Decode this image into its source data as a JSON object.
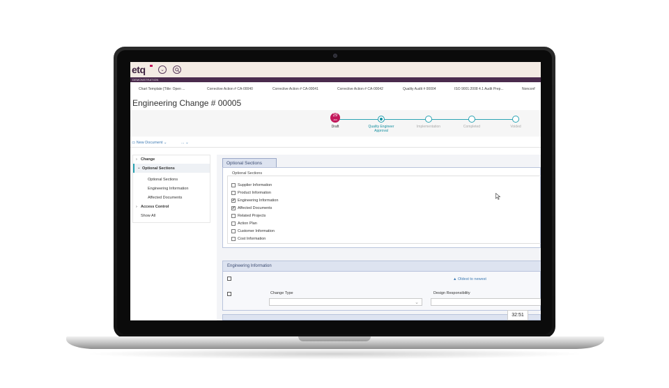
{
  "app": {
    "logo": "etq",
    "banner": "DEMONSTRATION",
    "header_icons": [
      "chevron-down-icon",
      "search-icon"
    ]
  },
  "tabs": [
    "Chart Template [Title: Open ...",
    "Corrective Action # CA-00040",
    "Corrective Action # CA-00041",
    "Corrective Action # CA-00042",
    "Quality Audit # 00004",
    "ISO 9001:2008 4.1 Audit Prep...",
    "Nonconf"
  ],
  "document": {
    "title": "Engineering Change # 00005"
  },
  "workflow": {
    "date_day": "29",
    "date_month": "JAN",
    "steps": [
      "Draft",
      "Quality Engineer Approval",
      "Implementation",
      "Completed",
      "Voided"
    ],
    "current_step": "Quality Engineer Approval"
  },
  "toolbar": {
    "new_document": "New Document ⌄",
    "more": "... ⌄"
  },
  "nav": {
    "change": "Change",
    "optional_sections": "Optional Sections",
    "sub_items": [
      "Optional Sections",
      "Engineering Information",
      "Affected Documents"
    ],
    "access_control": "Access Control",
    "show_all": "Show All"
  },
  "optional_sections": {
    "tab_label": "Optional Sections",
    "fieldset_label": "Optional Sections",
    "checkboxes": [
      {
        "label": "Supplier Information",
        "checked": false
      },
      {
        "label": "Product Information",
        "checked": false
      },
      {
        "label": "Engineering Information",
        "checked": true
      },
      {
        "label": "Affected Documents",
        "checked": true
      },
      {
        "label": "Related Projects",
        "checked": false
      },
      {
        "label": "Action Plan",
        "checked": false
      },
      {
        "label": "Customer Information",
        "checked": false
      },
      {
        "label": "Cost Information",
        "checked": false
      }
    ]
  },
  "engineering_information": {
    "header": "Engineering Information",
    "sort_link": "Oldest to newest",
    "change_type_label": "Change Type",
    "design_responsibility_label": "Design Responsibility"
  },
  "timer": "32:51",
  "colors": {
    "brand": "#3a1f3d",
    "accent": "#c2185b",
    "workflow": "#2aa3b3",
    "link": "#3d7ab3"
  }
}
